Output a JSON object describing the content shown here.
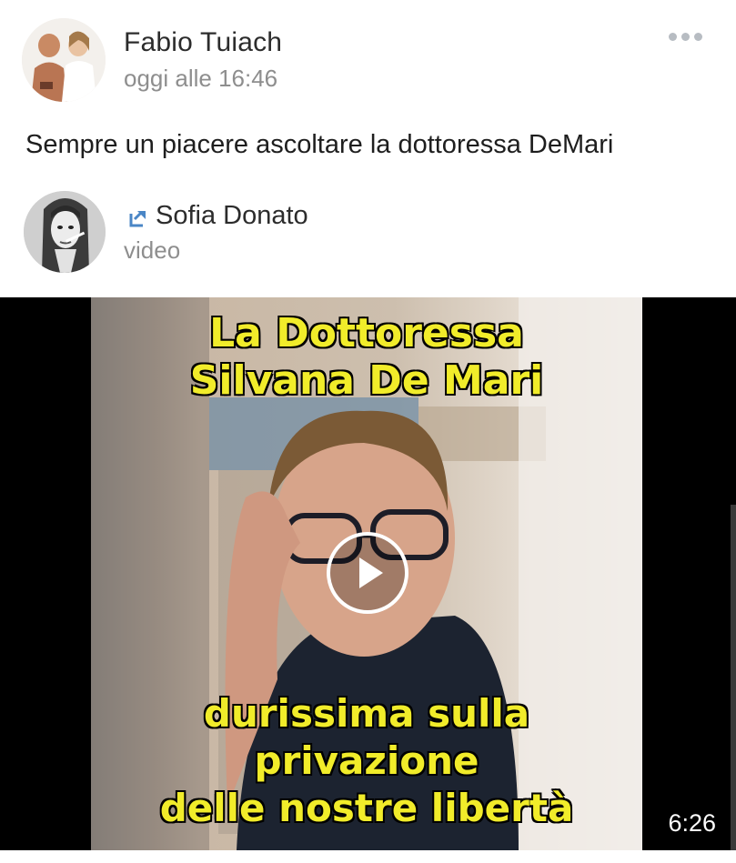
{
  "post": {
    "author": "Fabio Tuiach",
    "time": "oggi alle 16:46",
    "text": "Sempre un piacere ascoltare la dottoressa DeMari",
    "menu_icon": "more-dots-icon"
  },
  "shared": {
    "author": "Sofia Donato",
    "type": "video",
    "icon": "share-arrow-icon"
  },
  "video": {
    "caption_top": [
      "La Dottoressa",
      "Silvana De Mari"
    ],
    "caption_bottom": [
      "durissima sulla",
      "privazione",
      "delle nostre libertà"
    ],
    "duration": "6:26",
    "play_icon": "play-icon",
    "caption_color": "#f1ec2a"
  }
}
